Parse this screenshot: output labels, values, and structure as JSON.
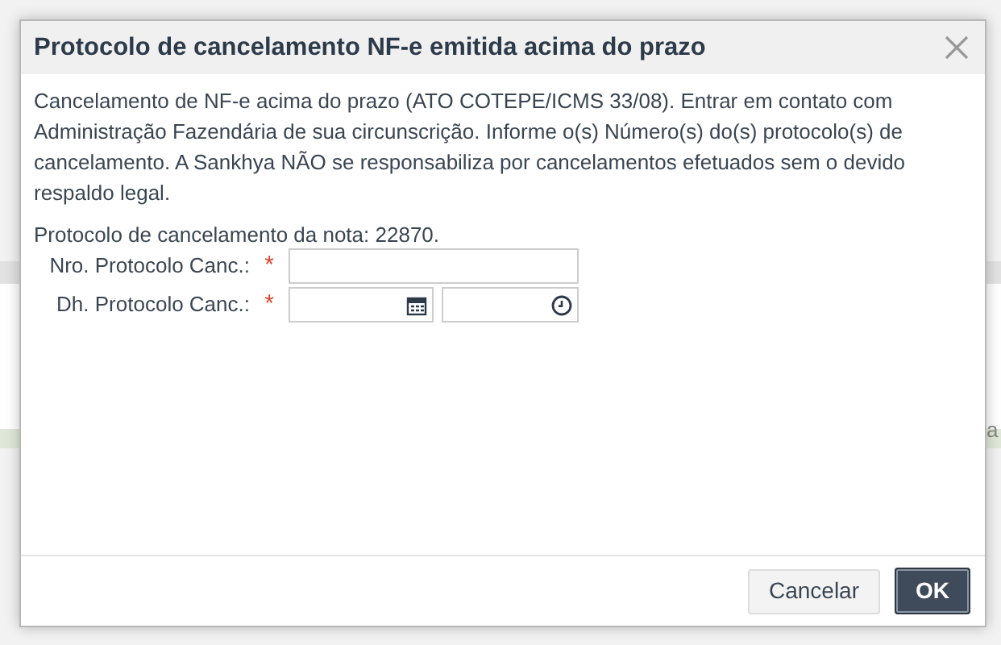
{
  "background": {
    "text": "a"
  },
  "dialog": {
    "title": "Protocolo de cancelamento NF-e emitida acima do prazo",
    "message": "Cancelamento de NF-e acima do prazo (ATO COTEPE/ICMS 33/08). Entrar em contato com Administração Fazendária de sua circunscrição. Informe o(s) Número(s) do(s) protocolo(s) de cancelamento. A Sankhya NÃO se responsabiliza por cancelamentos efetuados sem o devido respaldo legal.",
    "note": "Protocolo de cancelamento da nota: 22870.",
    "fields": [
      {
        "kind": "text",
        "label": "Nro. Protocolo Canc.:",
        "required_mark": "*"
      },
      {
        "kind": "datetime",
        "label": "Dh. Protocolo Canc.:",
        "required_mark": "*"
      }
    ],
    "buttons": [
      {
        "kind": "secondary",
        "label": "Cancelar"
      },
      {
        "kind": "primary",
        "label": "OK"
      }
    ]
  }
}
